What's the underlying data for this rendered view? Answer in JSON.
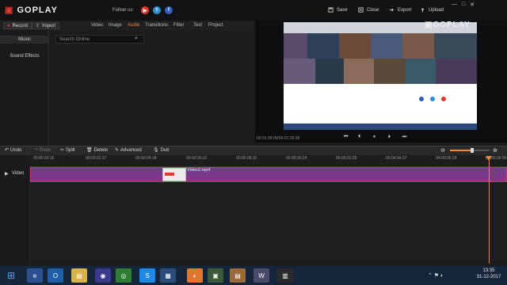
{
  "app": {
    "brand_mark": "▣",
    "brand_name": "GOPLAY"
  },
  "header": {
    "follow_label": "Follow us:",
    "social": [
      {
        "icon": "youtube-icon",
        "glyph": "▶",
        "color": "#e23a33"
      },
      {
        "icon": "twitter-icon",
        "glyph": "t",
        "color": "#2f93d6"
      },
      {
        "icon": "facebook-icon",
        "glyph": "f",
        "color": "#2f5fbd"
      }
    ],
    "buttons": [
      {
        "label": "Save",
        "icon": "save-icon"
      },
      {
        "label": "Close",
        "icon": "close-icon"
      },
      {
        "label": "Export",
        "icon": "export-icon"
      },
      {
        "label": "Upload",
        "icon": "upload-icon"
      }
    ]
  },
  "toolbar": {
    "record_label": "Record",
    "import_label": "Import"
  },
  "tabs": [
    {
      "label": "Video"
    },
    {
      "label": "Image"
    },
    {
      "label": "Audio",
      "active": true
    },
    {
      "label": "Transitions"
    },
    {
      "label": "Filter"
    },
    {
      "label": "Text"
    },
    {
      "label": "Project"
    }
  ],
  "sidebar": {
    "items": [
      {
        "label": "Music"
      },
      {
        "label": "Sound Effects"
      }
    ]
  },
  "search": {
    "placeholder": "Search Online"
  },
  "preview": {
    "time": "00:01:28:00/00:01:28:28"
  },
  "editbar": {
    "undo": "Undo",
    "redo": "Redo",
    "split": "Split",
    "delete": "Delete",
    "advanced": "Advanced",
    "dub": "Dub"
  },
  "timeline": {
    "ticks": [
      "00:00:20:16",
      "00:00:22:17",
      "00:00:24:18",
      "00:00:26:21",
      "00:00:28:22",
      "00:00:30:24",
      "00:00:32:25",
      "00:00:34:27",
      "00:00:36:29",
      "00:00:39:00"
    ],
    "track_label": "Video",
    "clip_label": "Video2.mp4"
  },
  "taskbar": {
    "time": "13:35",
    "date": "31-12-2017"
  }
}
